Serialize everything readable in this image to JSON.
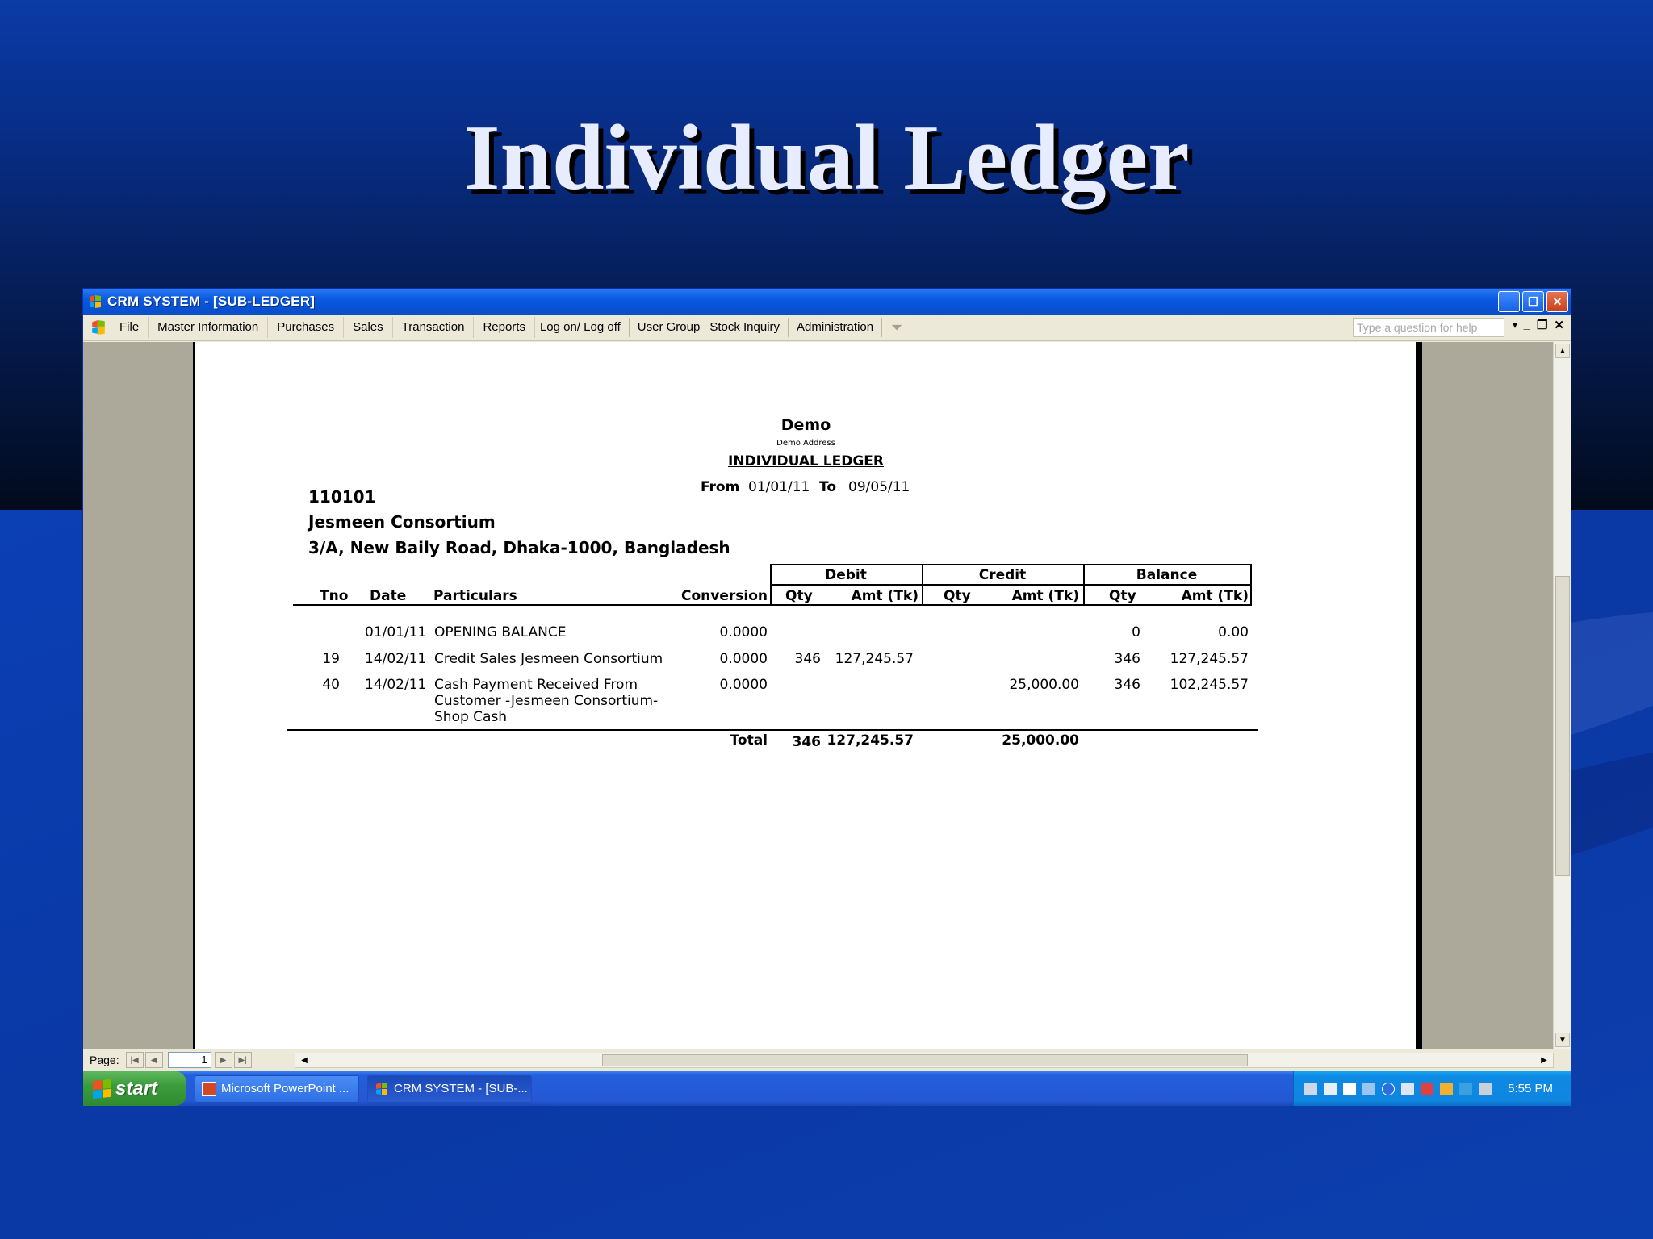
{
  "slide": {
    "title": "Individual Ledger"
  },
  "window": {
    "title": "CRM SYSTEM - [SUB-LEDGER]",
    "controls": {
      "minimize": "_",
      "restore": "❐",
      "close": "✕"
    }
  },
  "menu": {
    "items": [
      "File",
      "Master Information",
      "Purchases",
      "Sales",
      "Transaction",
      "Reports",
      "Log on/ Log off",
      "User Group",
      "Stock Inquiry",
      "Administration"
    ],
    "help_placeholder": "Type a question for help",
    "mdi": {
      "minimize": "_",
      "restore": "❐",
      "close": "✕"
    }
  },
  "report": {
    "company": "Demo",
    "address": "Demo Address",
    "title": "INDIVIDUAL LEDGER",
    "from_label": "From",
    "from_date": "01/01/11",
    "to_label": "To",
    "to_date": "09/05/11",
    "account_code": "110101",
    "account_name": "Jesmeen Consortium",
    "account_address": "3/A, New Baily Road, Dhaka-1000, Bangladesh",
    "groups": {
      "debit": "Debit",
      "credit": "Credit",
      "balance": "Balance"
    },
    "columns": {
      "tno": "Tno",
      "date": "Date",
      "particulars": "Particulars",
      "conversion": "Conversion",
      "debit_qty": "Qty",
      "debit_amt": "Amt (Tk)",
      "credit_qty": "Qty",
      "credit_amt": "Amt (Tk)",
      "balance_qty": "Qty",
      "balance_amt": "Amt (Tk)"
    },
    "rows": [
      {
        "tno": "",
        "date": "01/01/11",
        "particulars": [
          "OPENING BALANCE"
        ],
        "conversion": "0.0000",
        "debit_qty": "",
        "debit_amt": "",
        "credit_qty": "",
        "credit_amt": "",
        "balance_qty": "0",
        "balance_amt": "0.00"
      },
      {
        "tno": "19",
        "date": "14/02/11",
        "particulars": [
          "Credit Sales Jesmeen Consortium"
        ],
        "conversion": "0.0000",
        "debit_qty": "346",
        "debit_amt": "127,245.57",
        "credit_qty": "",
        "credit_amt": "",
        "balance_qty": "346",
        "balance_amt": "127,245.57"
      },
      {
        "tno": "40",
        "date": "14/02/11",
        "particulars": [
          "Cash Payment Received From",
          "Customer -Jesmeen Consortium-",
          "Shop Cash"
        ],
        "conversion": "0.0000",
        "debit_qty": "",
        "debit_amt": "",
        "credit_qty": "",
        "credit_amt": "25,000.00",
        "balance_qty": "346",
        "balance_amt": "102,245.57"
      }
    ],
    "total": {
      "label": "Total",
      "debit_qty": "346",
      "debit_amt": "127,245.57",
      "credit_amt": "25,000.00"
    }
  },
  "statusbar": {
    "page_label": "Page:",
    "page_value": "1"
  },
  "taskbar": {
    "start_label": "start",
    "tasks": [
      "Microsoft PowerPoint ...",
      "CRM SYSTEM - [SUB-..."
    ],
    "clock": "5:55 PM"
  }
}
